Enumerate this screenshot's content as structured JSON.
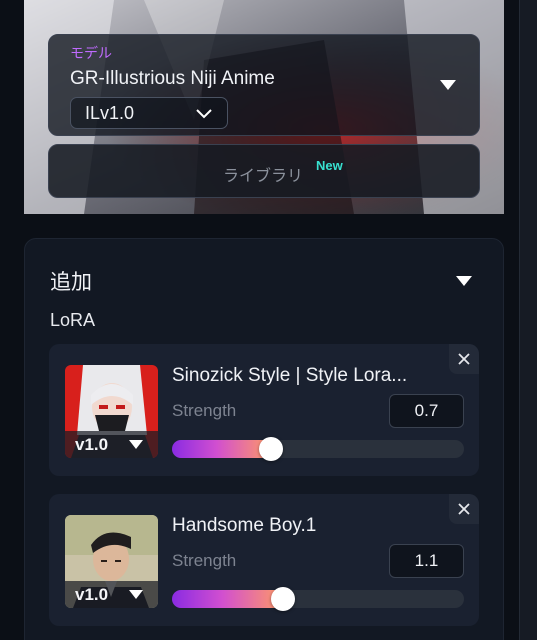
{
  "model": {
    "label": "モデル",
    "name": "GR-Illustrious Niji Anime",
    "version": "ILv1.0",
    "library_label": "ライブラリ",
    "library_badge": "New"
  },
  "additional": {
    "title": "追加",
    "lora_label": "LoRA",
    "loras": [
      {
        "name": "Sinozick Style | Style Lora...",
        "version": "v1.0",
        "strength_label": "Strength",
        "strength": "0.7",
        "slider_fraction": 0.34
      },
      {
        "name": "Handsome Boy.1",
        "version": "v1.0",
        "strength_label": "Strength",
        "strength": "1.1",
        "slider_fraction": 0.38
      }
    ]
  },
  "colors": {
    "accent_label": "#c06bff",
    "badge": "#38e1d0",
    "background": "#0b0f16"
  },
  "icons": [
    "chevron-down-icon",
    "close-icon"
  ]
}
